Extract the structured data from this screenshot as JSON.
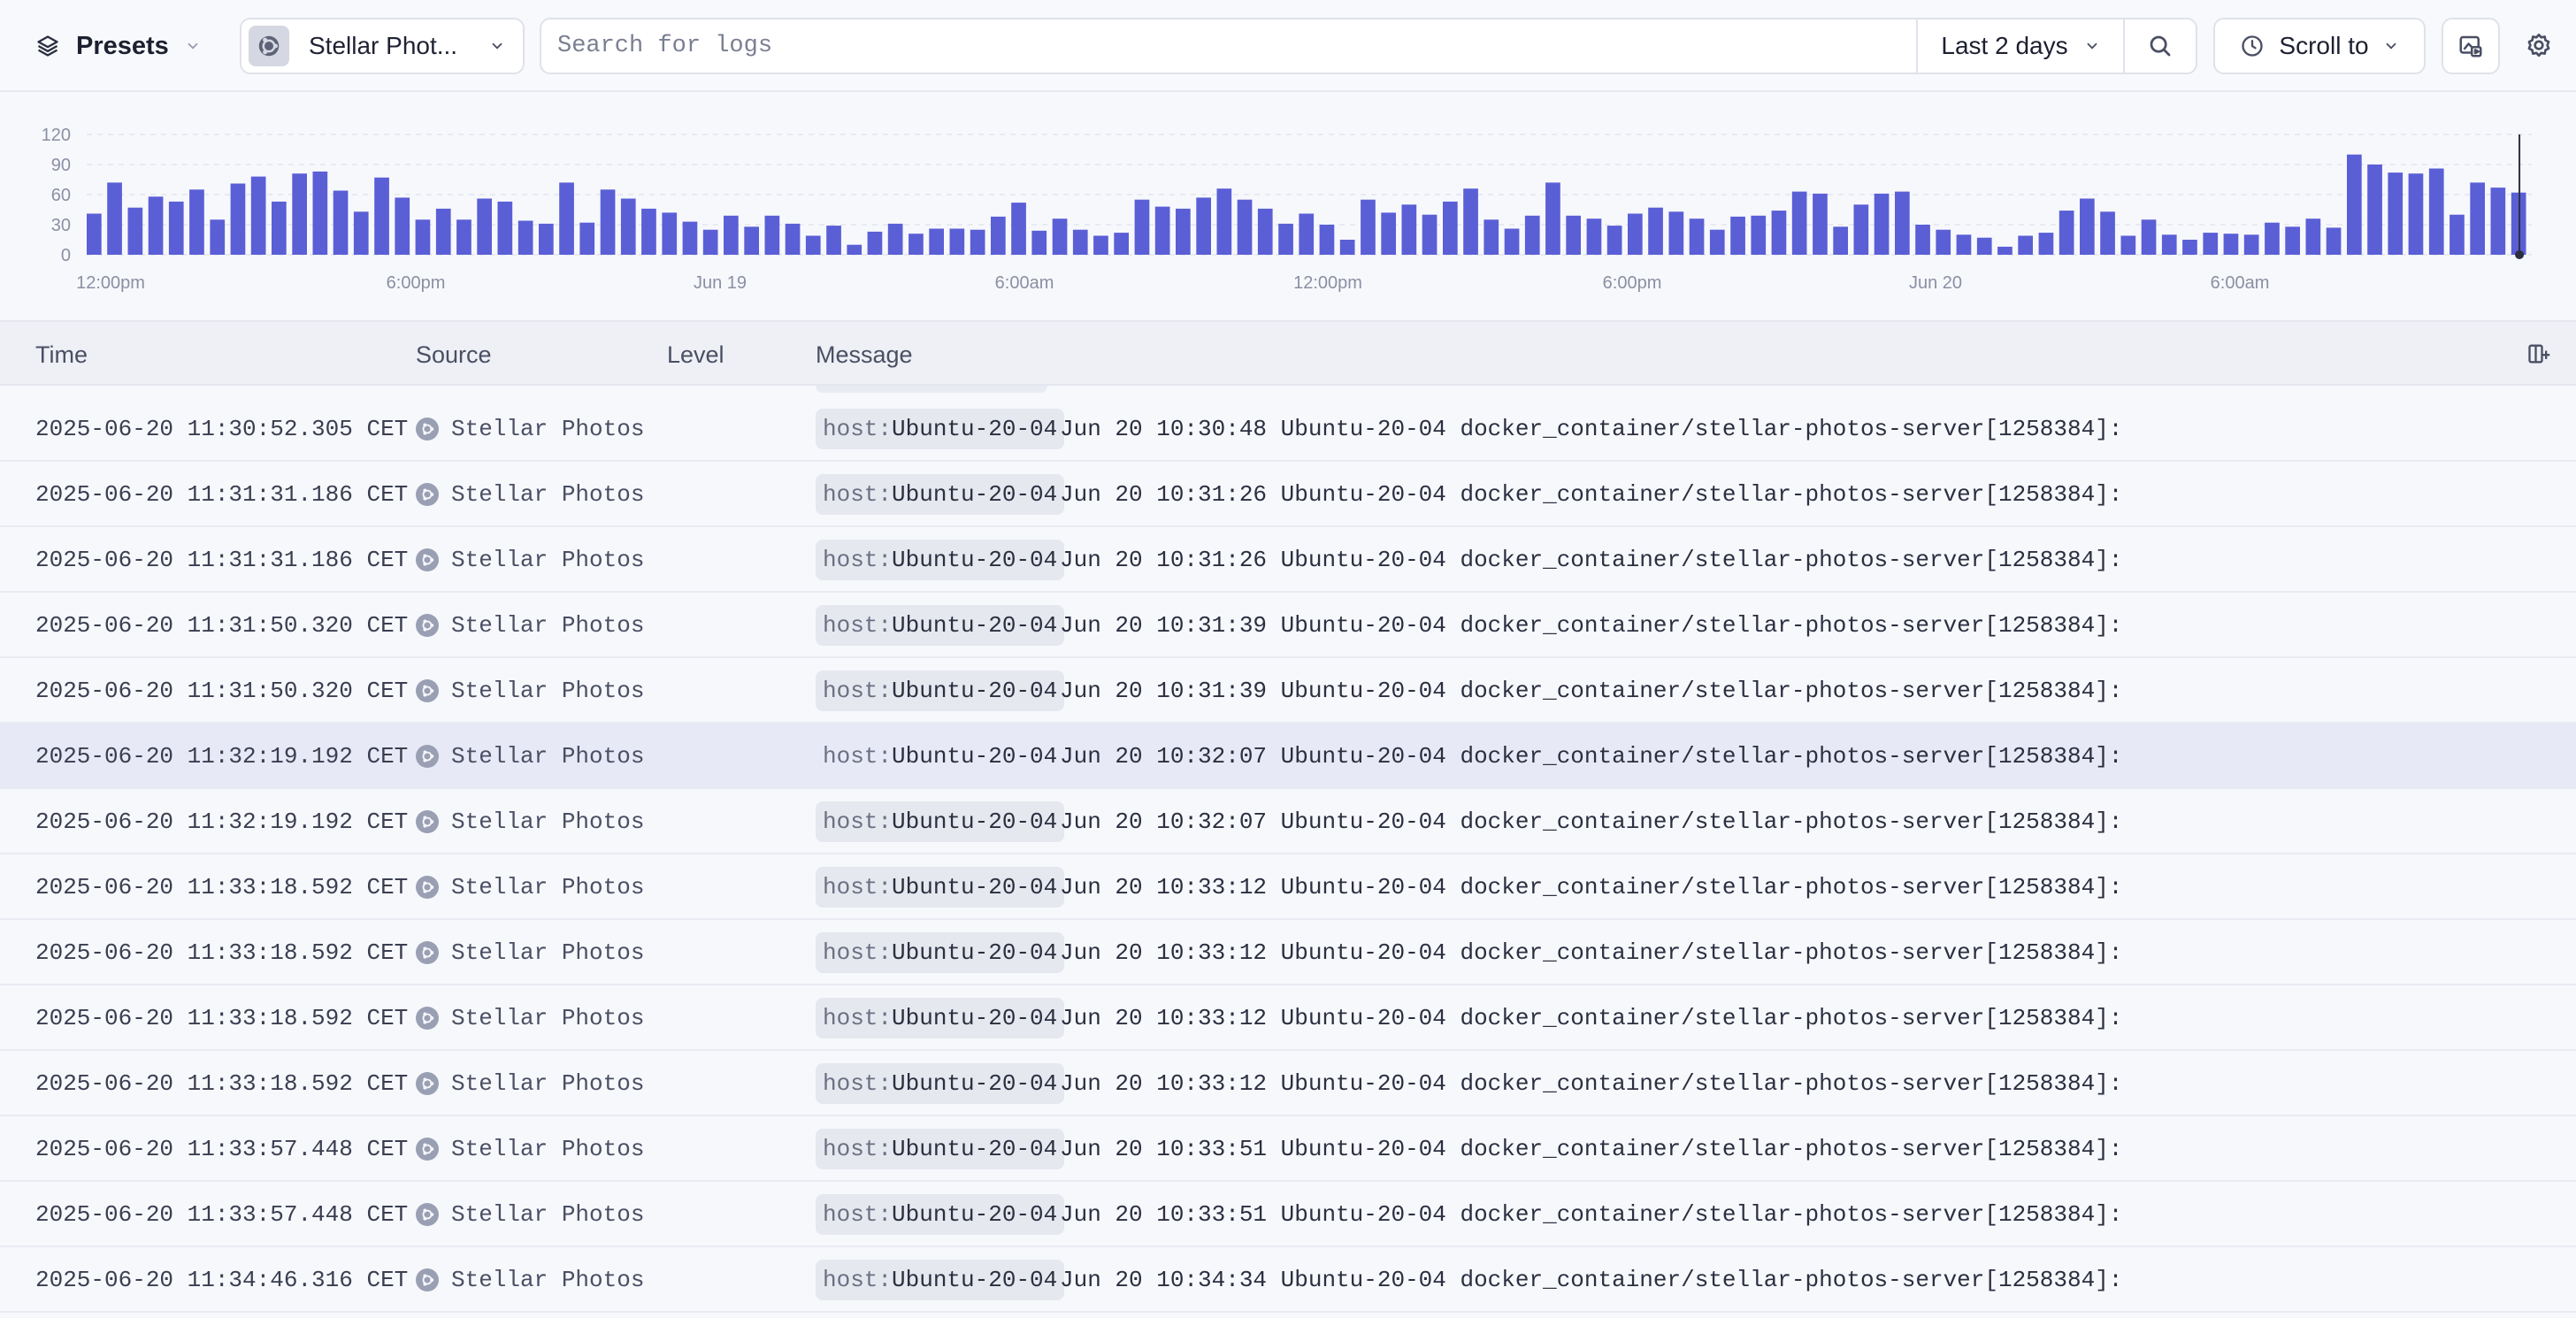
{
  "toolbar": {
    "presets_label": "Presets",
    "source_label": "Stellar Phot...",
    "search_placeholder": "Search for logs",
    "range_label": "Last 2 days",
    "scroll_label": "Scroll to"
  },
  "chart_data": {
    "type": "bar",
    "y_ticks": [
      "120",
      "90",
      "60",
      "30",
      "0"
    ],
    "ylim": [
      0,
      120
    ],
    "x_tick_labels": [
      "12:00pm",
      "6:00pm",
      "Jun 19",
      "6:00am",
      "12:00pm",
      "6:00pm",
      "Jun 20",
      "6:00am"
    ],
    "values": [
      41,
      72,
      47,
      58,
      53,
      65,
      35,
      71,
      78,
      53,
      81,
      83,
      64,
      43,
      77,
      57,
      35,
      46,
      35,
      56,
      53,
      34,
      31,
      72,
      32,
      65,
      56,
      46,
      42,
      33,
      25,
      39,
      28,
      39,
      31,
      19,
      29,
      10,
      23,
      31,
      21,
      26,
      26,
      25,
      38,
      52,
      24,
      36,
      25,
      19,
      22,
      55,
      48,
      46,
      57,
      66,
      55,
      46,
      31,
      41,
      30,
      15,
      55,
      42,
      50,
      40,
      53,
      66,
      35,
      26,
      39,
      72,
      39,
      36,
      29,
      41,
      47,
      43,
      36,
      25,
      38,
      39,
      44,
      63,
      61,
      28,
      50,
      61,
      63,
      30,
      25,
      20,
      17,
      8,
      19,
      22,
      44,
      56,
      43,
      19,
      35,
      20,
      15,
      22,
      21,
      20,
      32,
      28,
      36,
      27,
      100,
      90,
      82,
      81,
      86,
      40,
      72,
      67,
      62
    ],
    "bar_color": "#5a5fd6",
    "grid": true
  },
  "table": {
    "columns": [
      "Time",
      "Source",
      "Level",
      "Message"
    ],
    "tag_key": "host:",
    "rows": [
      {
        "time": "2025-06-20 11:30:52.305 CET",
        "source": "Stellar Photos",
        "host": "Ubuntu-20-04",
        "message": "Jun 20 10:30:48 Ubuntu-20-04 docker_container/stellar-photos-server[1258384]:"
      },
      {
        "time": "2025-06-20 11:31:31.186 CET",
        "source": "Stellar Photos",
        "host": "Ubuntu-20-04",
        "message": "Jun 20 10:31:26 Ubuntu-20-04 docker_container/stellar-photos-server[1258384]:"
      },
      {
        "time": "2025-06-20 11:31:31.186 CET",
        "source": "Stellar Photos",
        "host": "Ubuntu-20-04",
        "message": "Jun 20 10:31:26 Ubuntu-20-04 docker_container/stellar-photos-server[1258384]:"
      },
      {
        "time": "2025-06-20 11:31:50.320 CET",
        "source": "Stellar Photos",
        "host": "Ubuntu-20-04",
        "message": "Jun 20 10:31:39 Ubuntu-20-04 docker_container/stellar-photos-server[1258384]:"
      },
      {
        "time": "2025-06-20 11:31:50.320 CET",
        "source": "Stellar Photos",
        "host": "Ubuntu-20-04",
        "message": "Jun 20 10:31:39 Ubuntu-20-04 docker_container/stellar-photos-server[1258384]:"
      },
      {
        "time": "2025-06-20 11:32:19.192 CET",
        "source": "Stellar Photos",
        "host": "Ubuntu-20-04",
        "message": "Jun 20 10:32:07 Ubuntu-20-04 docker_container/stellar-photos-server[1258384]:",
        "selected": true
      },
      {
        "time": "2025-06-20 11:32:19.192 CET",
        "source": "Stellar Photos",
        "host": "Ubuntu-20-04",
        "message": "Jun 20 10:32:07 Ubuntu-20-04 docker_container/stellar-photos-server[1258384]:"
      },
      {
        "time": "2025-06-20 11:33:18.592 CET",
        "source": "Stellar Photos",
        "host": "Ubuntu-20-04",
        "message": "Jun 20 10:33:12 Ubuntu-20-04 docker_container/stellar-photos-server[1258384]:"
      },
      {
        "time": "2025-06-20 11:33:18.592 CET",
        "source": "Stellar Photos",
        "host": "Ubuntu-20-04",
        "message": "Jun 20 10:33:12 Ubuntu-20-04 docker_container/stellar-photos-server[1258384]:"
      },
      {
        "time": "2025-06-20 11:33:18.592 CET",
        "source": "Stellar Photos",
        "host": "Ubuntu-20-04",
        "message": "Jun 20 10:33:12 Ubuntu-20-04 docker_container/stellar-photos-server[1258384]:"
      },
      {
        "time": "2025-06-20 11:33:18.592 CET",
        "source": "Stellar Photos",
        "host": "Ubuntu-20-04",
        "message": "Jun 20 10:33:12 Ubuntu-20-04 docker_container/stellar-photos-server[1258384]:"
      },
      {
        "time": "2025-06-20 11:33:57.448 CET",
        "source": "Stellar Photos",
        "host": "Ubuntu-20-04",
        "message": "Jun 20 10:33:51 Ubuntu-20-04 docker_container/stellar-photos-server[1258384]:"
      },
      {
        "time": "2025-06-20 11:33:57.448 CET",
        "source": "Stellar Photos",
        "host": "Ubuntu-20-04",
        "message": "Jun 20 10:33:51 Ubuntu-20-04 docker_container/stellar-photos-server[1258384]:"
      },
      {
        "time": "2025-06-20 11:34:46.316 CET",
        "source": "Stellar Photos",
        "host": "Ubuntu-20-04",
        "message": "Jun 20 10:34:34 Ubuntu-20-04 docker_container/stellar-photos-server[1258384]:"
      }
    ]
  }
}
